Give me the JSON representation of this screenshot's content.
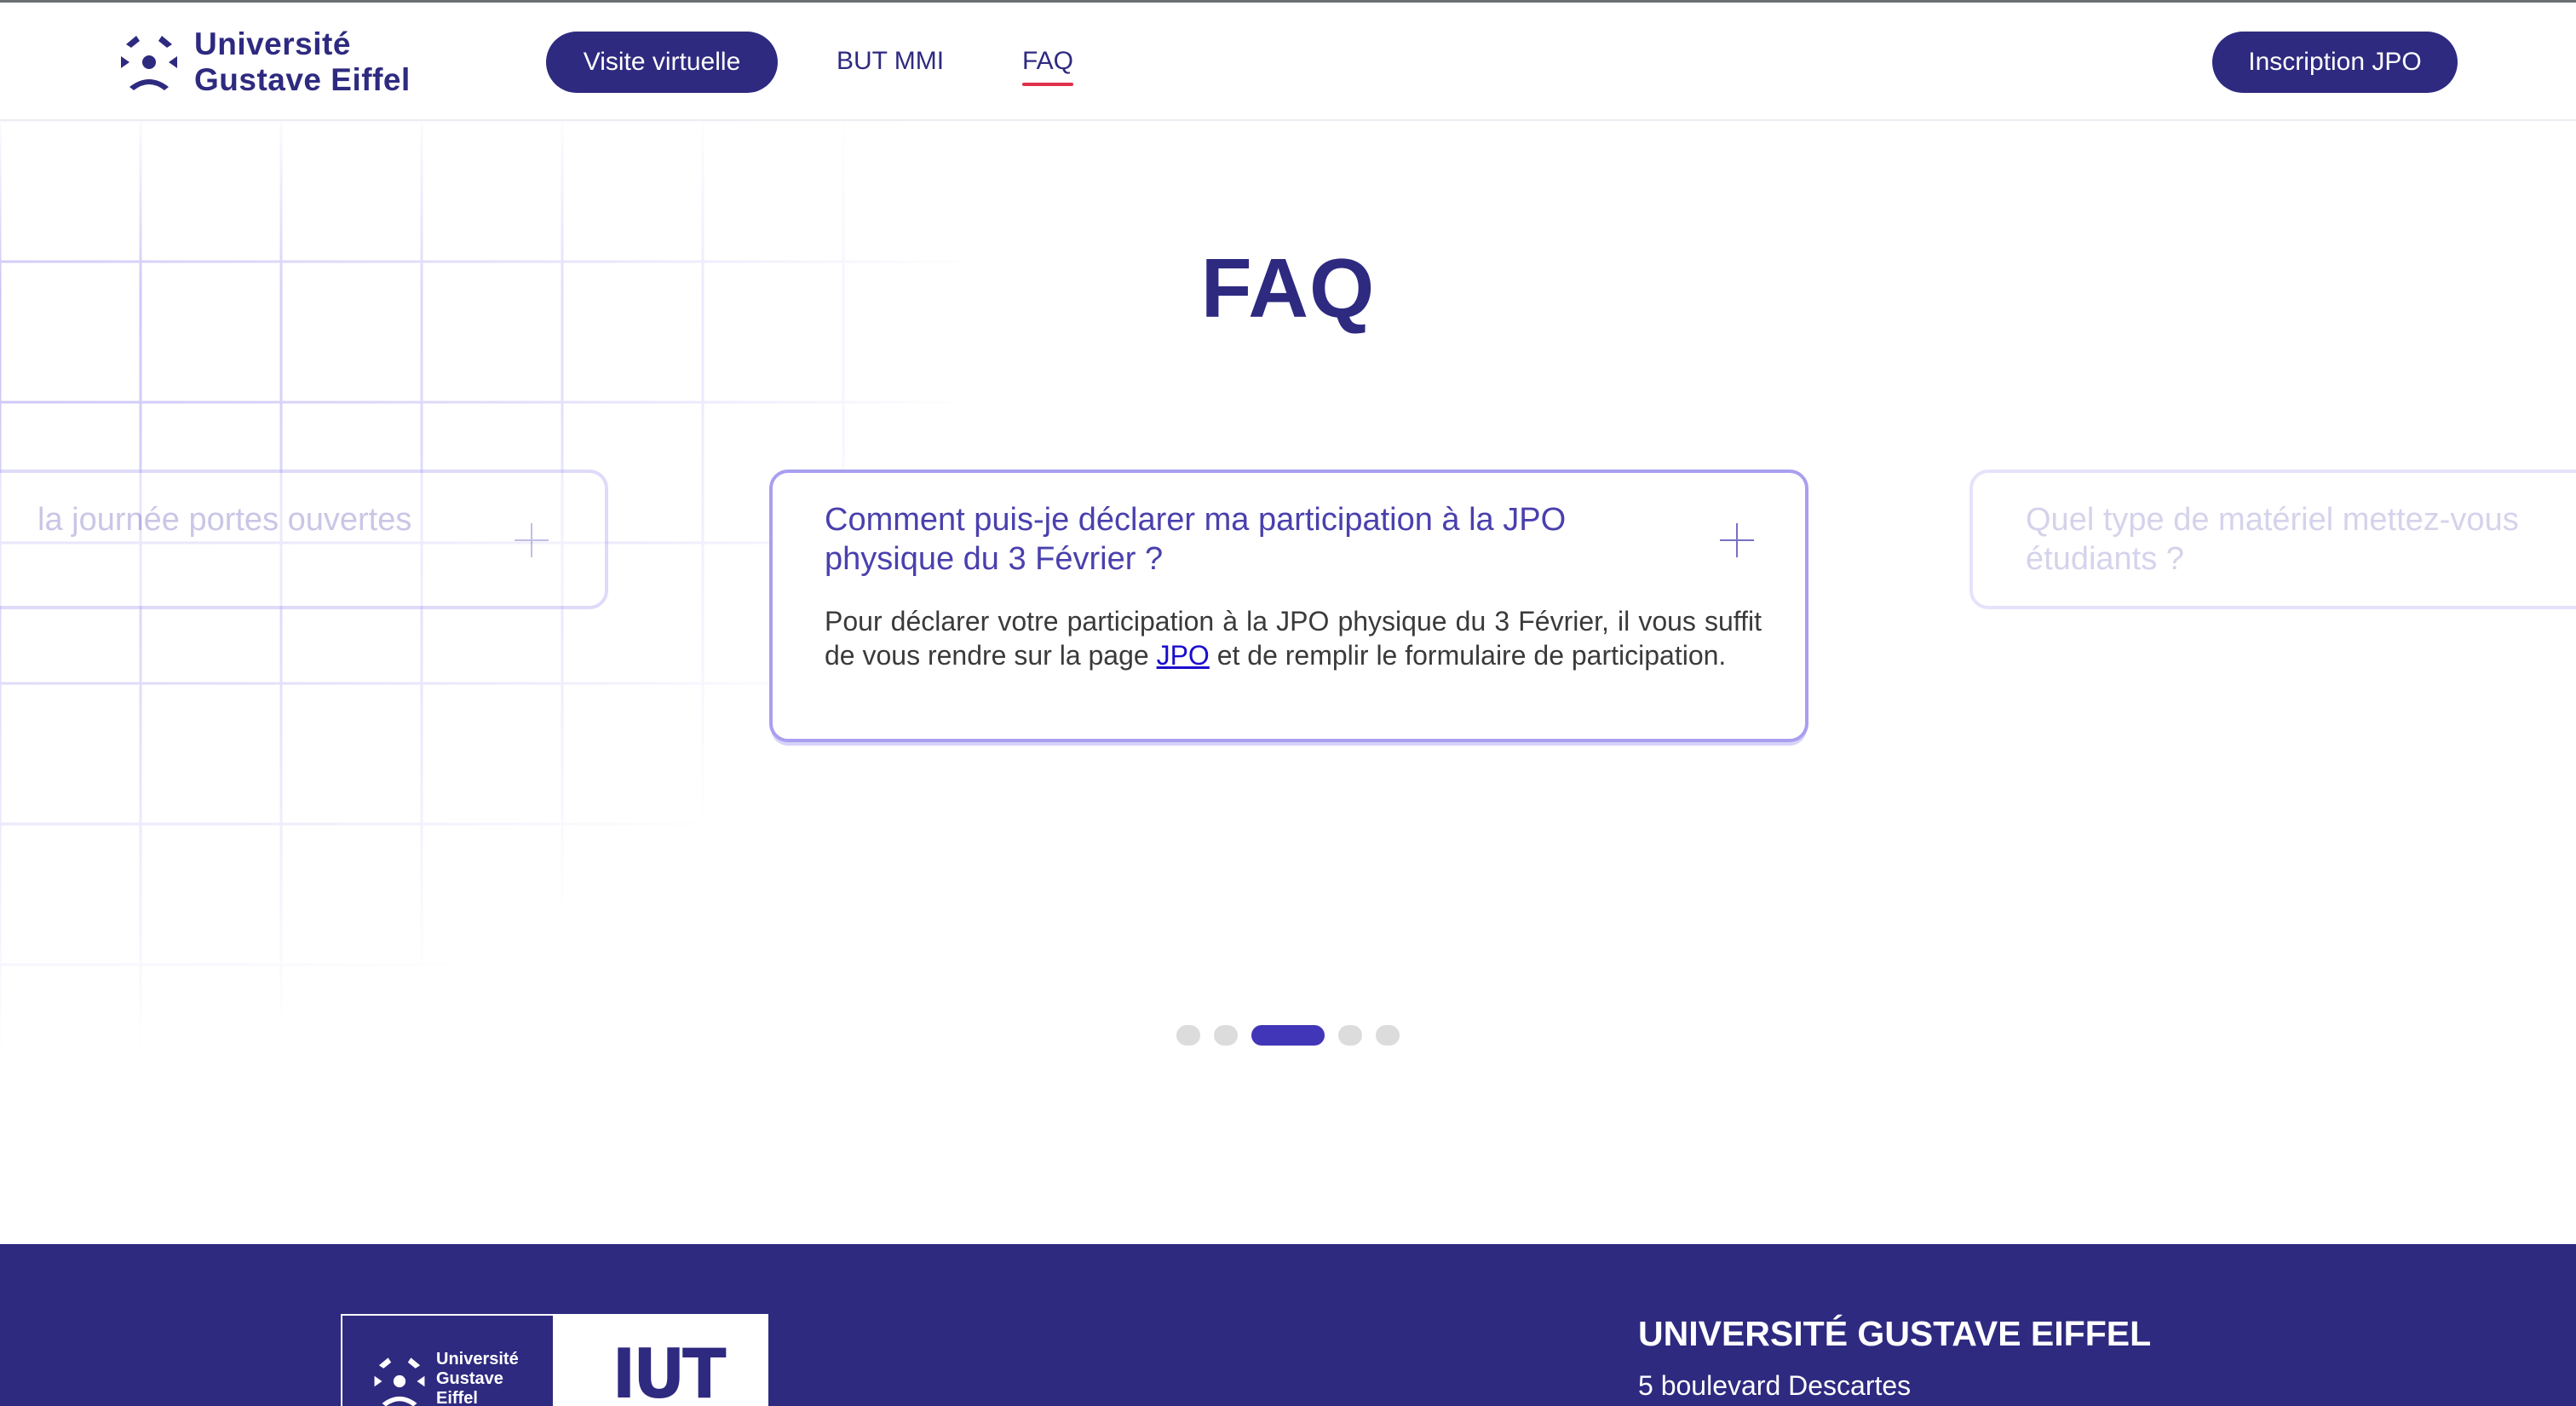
{
  "header": {
    "logo_line1": "Université",
    "logo_line2": "Gustave Eiffel",
    "nav": {
      "virtual_visit": "Visite virtuelle",
      "but_mmi": "BUT MMI",
      "faq": "FAQ"
    },
    "cta_label": "Inscription JPO"
  },
  "main": {
    "title": "FAQ",
    "cards": {
      "left": {
        "question": "la journée portes ouvertes"
      },
      "main": {
        "question": "Comment puis-je déclarer ma participation à la JPO physique du 3 Février ?",
        "answer_before_link": "Pour déclarer votre participation à la JPO physique du 3 Février, il vous suffit de vous rendre sur la page ",
        "answer_link": "JPO",
        "answer_after_link": " et de remplir le formulaire de participation."
      },
      "right": {
        "question_line1": "Quel type de matériel mettez-vous",
        "question_line2": "étudiants ?"
      }
    },
    "carousel": {
      "total": 5,
      "active_index": 2
    }
  },
  "footer": {
    "logo_line1": "Université",
    "logo_line2": "Gustave",
    "logo_line3": "Eiffel",
    "iut_logo": "IUT",
    "title": "UNIVERSITÉ GUSTAVE EIFFEL",
    "address": "5 boulevard Descartes"
  },
  "colors": {
    "brand": "#2e2a80",
    "accent": "#4136b8",
    "underline": "#e0314b",
    "card_border": "#b7b0f2"
  }
}
